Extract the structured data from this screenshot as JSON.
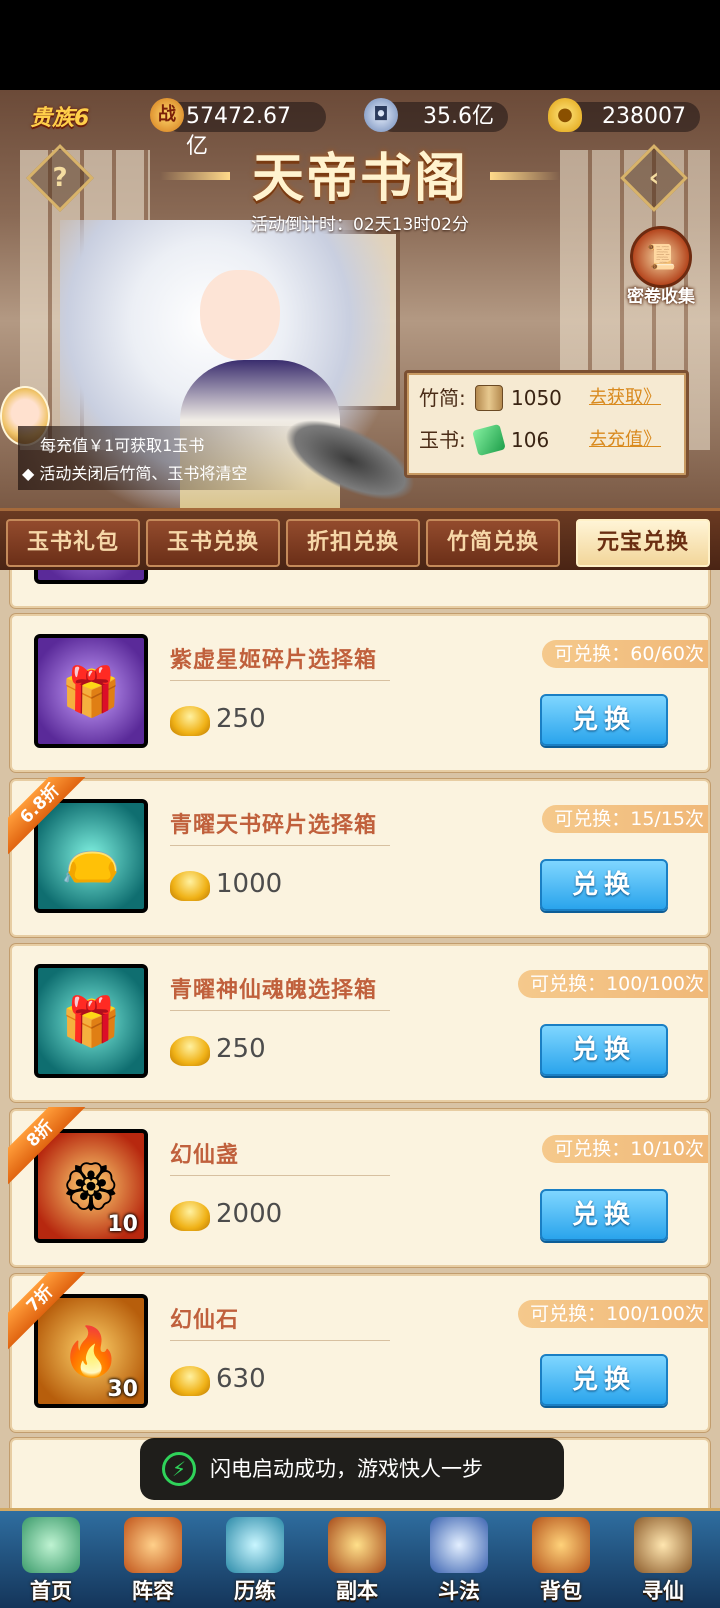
{
  "header": {
    "noble_label": "贵族6",
    "power": "57472.67亿",
    "copper": "35.6亿",
    "ingot": "238007"
  },
  "event": {
    "title": "天帝书阁",
    "countdown": "活动倒计时：02天13时02分",
    "help_icon": "?",
    "scroll_collect_label": "密卷收集",
    "tips": [
      "每充值￥1可获取1玉书",
      "◆ 活动关闭后竹简、玉书将清空"
    ]
  },
  "resources": {
    "bamboo_label": "竹简:",
    "bamboo_value": "1050",
    "bamboo_link": "去获取》",
    "jade_label": "玉书:",
    "jade_value": "106",
    "jade_link": "去充值》"
  },
  "tabs": [
    {
      "label": "玉书礼包",
      "active": false
    },
    {
      "label": "玉书兑换",
      "active": false
    },
    {
      "label": "折扣兑换",
      "active": false
    },
    {
      "label": "竹简兑换",
      "active": false
    },
    {
      "label": "元宝兑换",
      "active": true
    }
  ],
  "items": [
    {
      "name": "紫虚星姬碎片选择箱",
      "price": "250",
      "limit": "可兑换：60/60次",
      "button": "兑换",
      "discount": "",
      "qty": "",
      "frame": "purple",
      "icon": "chest-icon"
    },
    {
      "name": "青曜天书碎片选择箱",
      "price": "1000",
      "limit": "可兑换：15/15次",
      "button": "兑换",
      "discount": "6.8折",
      "qty": "",
      "frame": "teal",
      "icon": "bag-icon"
    },
    {
      "name": "青曜神仙魂魄选择箱",
      "price": "250",
      "limit": "可兑换：100/100次",
      "button": "兑换",
      "discount": "",
      "qty": "",
      "frame": "teal",
      "icon": "chest-icon"
    },
    {
      "name": "幻仙盏",
      "price": "2000",
      "limit": "可兑换：10/10次",
      "button": "兑换",
      "discount": "8折",
      "qty": "10",
      "frame": "red",
      "icon": "lotus-lamp-icon"
    },
    {
      "name": "幻仙石",
      "price": "630",
      "limit": "可兑换：100/100次",
      "button": "兑换",
      "discount": "7折",
      "qty": "30",
      "frame": "orange",
      "icon": "fire-orb-icon"
    }
  ],
  "toast": "闪电启动成功，游戏快人一步",
  "nav": [
    {
      "label": "首页",
      "icon": "home-icon"
    },
    {
      "label": "阵容",
      "icon": "lineup-icon"
    },
    {
      "label": "历练",
      "icon": "training-icon"
    },
    {
      "label": "副本",
      "icon": "dungeon-icon"
    },
    {
      "label": "斗法",
      "icon": "battle-icon"
    },
    {
      "label": "背包",
      "icon": "bag-icon"
    },
    {
      "label": "寻仙",
      "icon": "seek-immortal-icon"
    }
  ]
}
